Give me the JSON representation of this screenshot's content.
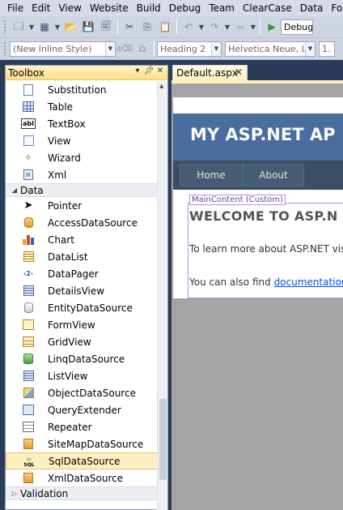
{
  "menu": [
    "File",
    "Edit",
    "View",
    "Website",
    "Build",
    "Debug",
    "Team",
    "ClearCase",
    "Data",
    "Fo"
  ],
  "toolbar1": {
    "config_value": "Debug"
  },
  "toolbar2": {
    "style_value": "(New Inline Style)",
    "block_format": "Heading 2",
    "font_family": "Helvetica Neue, L",
    "font_size": "1."
  },
  "toolbox": {
    "title": "Toolbox",
    "items_top": [
      "Substitution",
      "Table",
      "TextBox",
      "View",
      "Wizard",
      "Xml"
    ],
    "category_data": "Data",
    "data_items": [
      "Pointer",
      "AccessDataSource",
      "Chart",
      "DataList",
      "DataPager",
      "DetailsView",
      "EntityDataSource",
      "FormView",
      "GridView",
      "LinqDataSource",
      "ListView",
      "ObjectDataSource",
      "QueryExtender",
      "Repeater",
      "SiteMapDataSource",
      "SqlDataSource",
      "XmlDataSource"
    ],
    "selected_item": "SqlDataSource",
    "category_validation": "Validation"
  },
  "document": {
    "tab_label": "Default.aspx",
    "site_title": "MY ASP.NET AP",
    "nav_home": "Home",
    "nav_about": "About",
    "content_tag": "MainContent (Custom)",
    "heading": "WELCOME TO ASP.N",
    "para1": "To learn more about ASP.NET vis",
    "para2_prefix": "You can also find ",
    "para2_link": "documentation"
  },
  "colors": {
    "chrome_bg": "#2b3c59",
    "header_blue": "#4b6c9e",
    "nav_dark": "#3a4f63",
    "selection": "#fdf0c0",
    "content_border": "#b48edc"
  }
}
